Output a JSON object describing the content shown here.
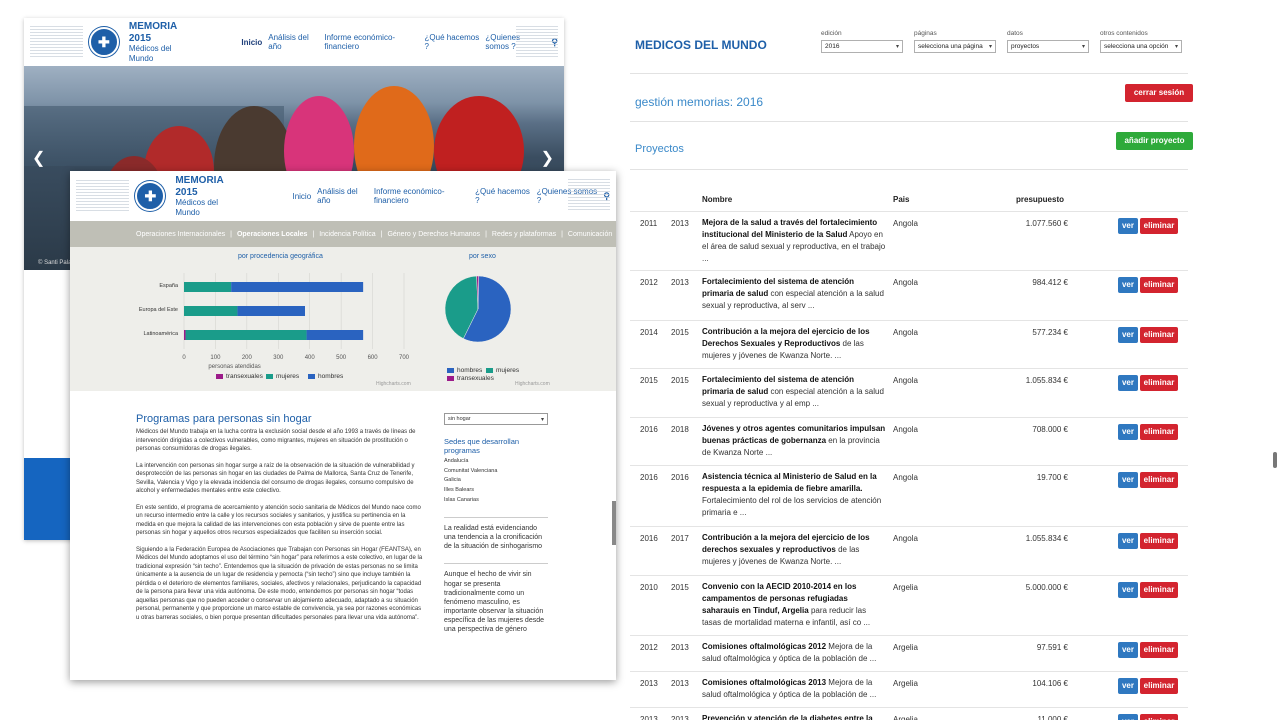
{
  "back_site": {
    "header": {
      "title": "MEMORIA 2015",
      "subtitle": "Médicos del Mundo"
    },
    "nav": [
      "Inicio",
      "Análisis del año",
      "Informe económico-financiero",
      "¿Qué hacemos ?",
      "¿Quienes somos ?"
    ],
    "hero_credit": "© Santi Pala..."
  },
  "front_site": {
    "header": {
      "title": "MEMORIA 2015",
      "subtitle": "Médicos del Mundo"
    },
    "nav": [
      "Inicio",
      "Análisis del año",
      "Informe económico-financiero",
      "¿Qué hacemos ?",
      "¿Quienes somos ?"
    ],
    "subnav": [
      "Operaciones Internacionales",
      "Operaciones Locales",
      "Incidencia Política",
      "Género y Derechos Humanos",
      "Redes y plataformas",
      "Comunicación"
    ],
    "charts": {
      "bar_title": "por procedencia geográfica",
      "pie_title": "por sexo",
      "credit": "Highcharts.com"
    },
    "content": {
      "heading": "Programas para personas sin hogar",
      "paragraphs": [
        "Médicos del Mundo trabaja en la lucha contra la exclusión social desde el año 1993 a través de líneas de intervención dirigidas a colectivos vulnerables, como migrantes, mujeres en situación de prostitución o personas consumidoras de drogas ilegales.",
        "La intervención con personas sin hogar surge a raíz de la observación de la situación de vulnerabilidad y desprotección de las personas sin hogar en las ciudades de Palma de Mallorca, Santa Cruz de Tenerife, Sevilla, Valencia y Vigo y la elevada incidencia del consumo de drogas ilegales, consumo compulsivo de alcohol y enfermedades mentales entre este colectivo.",
        "En este sentido, el programa de acercamiento y atención socio sanitaria de Médicos del Mundo nace como un recurso intermedio entre la calle y los recursos sociales y sanitarios, y justifica su pertinencia en la medida en que mejora la calidad de las intervenciones con esta población y sirve de puente entre las personas sin hogar y aquellos otros recursos especializados que faciliten su inserción social.",
        "Siguiendo a la Federación Europea de Asociaciones que Trabajan con Personas sin Hogar (FEANTSA), en Médicos del Mundo adoptamos el uso del término “sin hogar” para referirnos a este colectivo, en lugar de la tradicional expresión “sin techo”. Entendemos que la situación de privación de estas personas no se limita únicamente a la ausencia de un lugar de residencia y pernocta (“sin techo”) sino que incluye también la pérdida o el deterioro de elementos familiares, sociales, afectivos y relacionales, perjudicando la capacidad de la persona para llevar una vida autónoma. De este modo, entendemos por personas sin hogar “todas aquellas personas que no pueden acceder o conservar un alojamiento adecuado, adaptado a su situación personal, permanente y que proporcione un marco estable de convivencia, ya sea por razones económicas u otras barreras sociales, o bien porque presentan dificultades personales para llevar una vida autónoma”."
      ],
      "side_select": "sin hogar",
      "side_heading": "Sedes que desarrollan programas",
      "sedes": [
        "Andalucía",
        "Comunitat Valenciana",
        "Galicia",
        "Illes Balears",
        "Islas Canarias"
      ],
      "quote1": "La realidad está evidenciando una tendencia a la cronificación de la situación de sinhogarismo",
      "quote2": "Aunque el hecho de vivir sin hogar se presenta tradicionalmente como un fenómeno masculino, es importante observar la situación específica de las mujeres desde una perspectiva de género"
    }
  },
  "chart_data": [
    {
      "type": "bar",
      "title": "por procedencia geográfica",
      "xlabel": "personas atendidas",
      "stacked": true,
      "orientation": "horizontal",
      "categories": [
        "España",
        "Europa del Este",
        "Latinoamérica"
      ],
      "series": [
        {
          "name": "transexuales",
          "color": "#9c1b8a",
          "values": [
            0,
            0,
            5
          ]
        },
        {
          "name": "mujeres",
          "color": "#1a9c8a",
          "values": [
            150,
            170,
            385
          ]
        },
        {
          "name": "hombres",
          "color": "#2a63c0",
          "values": [
            420,
            215,
            180
          ]
        }
      ],
      "xlim": [
        0,
        700
      ],
      "xticks": [
        0,
        100,
        200,
        300,
        400,
        500,
        600,
        700
      ]
    },
    {
      "type": "pie",
      "title": "por sexo",
      "series": [
        {
          "name": "hombres",
          "color": "#2a63c0",
          "value": 57
        },
        {
          "name": "mujeres",
          "color": "#1a9c8a",
          "value": 42
        },
        {
          "name": "transexuales",
          "color": "#9c1b8a",
          "value": 1
        }
      ]
    }
  ],
  "admin": {
    "title": "MEDICOS DEL MUNDO",
    "filters": [
      {
        "label": "edición",
        "value": "2016"
      },
      {
        "label": "páginas",
        "value": "selecciona una página"
      },
      {
        "label": "datos",
        "value": "proyectos"
      },
      {
        "label": "otros contenidos",
        "value": "selecciona una opción"
      }
    ],
    "section_title": "gestión memorias: 2016",
    "logout": "cerrar sesión",
    "projects_title": "Proyectos",
    "add_project": "añadir proyecto",
    "columns": {
      "name": "Nombre",
      "country": "Pais",
      "budget": "presupuesto"
    },
    "view_label": "ver",
    "delete_label": "eliminar",
    "rows": [
      {
        "y1": "2011",
        "y2": "2013",
        "title": "Mejora de la salud a través del fortalecimiento institucional del Ministerio de la Salud",
        "desc": "Apoyo en el área de salud sexual y reproductiva, en el trabajo ...",
        "country": "Angola",
        "budget": "1.077.560 €"
      },
      {
        "y1": "2012",
        "y2": "2013",
        "title": "Fortalecimiento del sistema de atención primaria de salud",
        "desc": "con especial atención a la salud sexual y reproductiva, al serv ...",
        "country": "Angola",
        "budget": "984.412 €"
      },
      {
        "y1": "2014",
        "y2": "2015",
        "title": "Contribución a la mejora del ejercicio de los Derechos Sexuales y Reproductivos",
        "desc": "de las mujeres y jóvenes de Kwanza Norte. ...",
        "country": "Angola",
        "budget": "577.234 €"
      },
      {
        "y1": "2015",
        "y2": "2015",
        "title": "Fortalecimiento del sistema de atención primaria de salud",
        "desc": "con especial atención a la salud sexual y reproductiva y al emp ...",
        "country": "Angola",
        "budget": "1.055.834 €"
      },
      {
        "y1": "2016",
        "y2": "2018",
        "title": "Jóvenes y otros agentes comunitarios impulsan buenas prácticas de gobernanza",
        "desc": "en la provincia de Kwanza Norte ...",
        "country": "Angola",
        "budget": "708.000 €"
      },
      {
        "y1": "2016",
        "y2": "2016",
        "title": "Asistencia técnica al Ministerio de Salud en la respuesta a la epidemia de fiebre amarilla.",
        "desc": "Fortalecimiento del rol de los servicios de atención primaria e ...",
        "country": "Angola",
        "budget": "19.700 €"
      },
      {
        "y1": "2016",
        "y2": "2017",
        "title": "Contribución a la mejora del ejercicio de los derechos sexuales y reproductivos",
        "desc": "de las mujeres y jóvenes de Kwanza Norte. ...",
        "country": "Angola",
        "budget": "1.055.834 €"
      },
      {
        "y1": "2010",
        "y2": "2015",
        "title": "Convenio con la AECID 2010-2014 en los campamentos de personas refugiadas saharauis en Tinduf, Argelia",
        "desc": "para reducir las tasas de mortalidad materna e infantil, así co ...",
        "country": "Argelia",
        "budget": "5.000.000 €"
      },
      {
        "y1": "2012",
        "y2": "2013",
        "title": "Comisiones oftalmológicas 2012",
        "desc": "Mejora de la salud oftalmológica y óptica de la población de ...",
        "country": "Argelia",
        "budget": "97.591 €"
      },
      {
        "y1": "2013",
        "y2": "2013",
        "title": "Comisiones oftalmológicas 2013",
        "desc": "Mejora de la salud oftalmológica y óptica de la población de ...",
        "country": "Argelia",
        "budget": "104.106 €"
      },
      {
        "y1": "2013",
        "y2": "2013",
        "title": "Prevención y atención de la diabetes entre la",
        "desc": "",
        "country": "Argelia",
        "budget": "11.000 €"
      }
    ]
  }
}
